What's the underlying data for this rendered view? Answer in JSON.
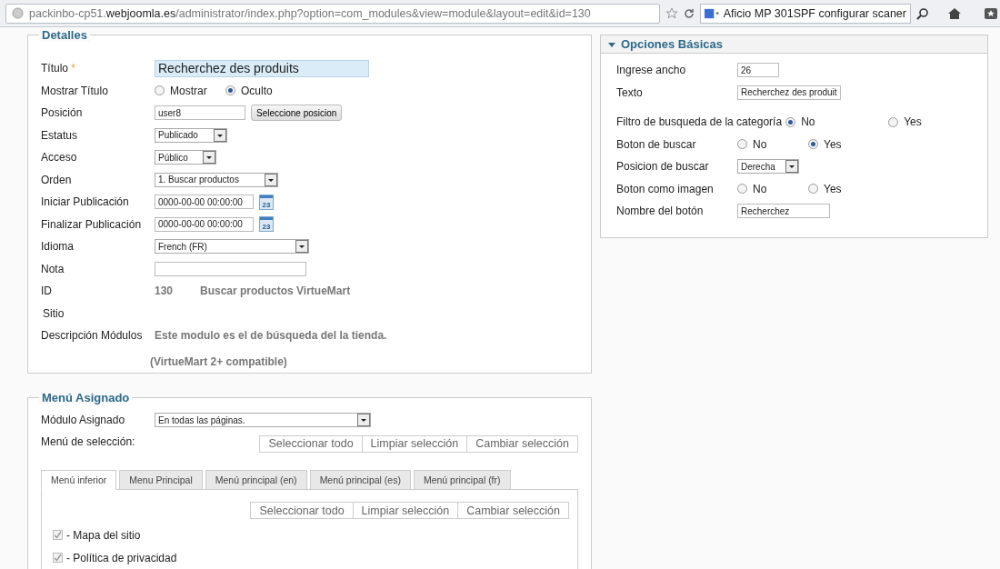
{
  "browser": {
    "url": "packinbo-cp51.**webjoomla.es**/administrator/index.php?option=com_modules&view=module&layout=edit&id=130",
    "search_text": "Aficio MP 301SPF configurar scaner"
  },
  "details": {
    "legend": "Detalles",
    "fields": [
      {
        "kind": "title",
        "label": "Título",
        "required_mark": "*",
        "value": "Recherchez des produits"
      },
      {
        "kind": "radio",
        "label": "Mostrar Título",
        "options": [
          {
            "label": "Mostrar",
            "selected": false
          },
          {
            "label": "Oculto",
            "selected": true
          }
        ]
      },
      {
        "kind": "text_button",
        "label": "Posición",
        "value": "user8",
        "button": "Seleccione posicion"
      },
      {
        "kind": "select",
        "label": "Estatus",
        "value": "Publicado"
      },
      {
        "kind": "select",
        "label": "Acceso",
        "value": "Público"
      },
      {
        "kind": "select",
        "label": "Orden",
        "value": "1. Buscar productos"
      },
      {
        "kind": "date",
        "label": "Iniciar Publicación",
        "value": "0000-00-00 00:00:00",
        "calendar_day": "23"
      },
      {
        "kind": "date",
        "label": "Finalizar Publicación",
        "value": "0000-00-00 00:00:00",
        "calendar_day": "23"
      },
      {
        "kind": "select",
        "label": "Idioma",
        "value": "French (FR)"
      },
      {
        "kind": "text",
        "label": "Nota"
      },
      {
        "kind": "id",
        "label": "ID",
        "value": "130",
        "name": "Buscar productos VirtueMart"
      },
      {
        "kind": "plain",
        "label": "Sitio"
      },
      {
        "kind": "description",
        "label": "Descripción Módulos",
        "lines": [
          "Este modulo es el de búsqueda del la tienda.",
          "(VirtueMart 2+ compatible)"
        ]
      }
    ]
  },
  "basic_options": {
    "title": "Opciones Básicas",
    "expanded": true,
    "fields": [
      {
        "kind": "text",
        "label": "Ingrese ancho",
        "value": "26"
      },
      {
        "kind": "text",
        "label": "Texto",
        "value": "Recherchez des produit"
      },
      {
        "kind": "radio",
        "label": "Filtro de busqueda de la categoría",
        "options": [
          {
            "label": "No",
            "selected": true
          },
          {
            "label": "Yes",
            "selected": false
          }
        ]
      },
      {
        "kind": "radio",
        "label": "Boton de buscar",
        "options": [
          {
            "label": "No",
            "selected": false
          },
          {
            "label": "Yes",
            "selected": true
          }
        ]
      },
      {
        "kind": "select",
        "label": "Posicion de buscar",
        "value": "Derecha"
      },
      {
        "kind": "radio",
        "label": "Boton como imagen",
        "options": [
          {
            "label": "No",
            "selected": false
          },
          {
            "label": "Yes",
            "selected": false
          }
        ]
      },
      {
        "kind": "text",
        "label": "Nombre del botón",
        "value": "Recherchez"
      }
    ]
  },
  "menu_assignment": {
    "legend": "Menú Asignado",
    "module_label": "Módulo Asignado",
    "module_value": "En todas las páginas.",
    "selection_label": "Menú de selección:",
    "buttons": [
      "Seleccionar todo",
      "Limpiar selección",
      "Cambiar selección"
    ],
    "tabs": [
      {
        "label": "Menú inferior",
        "selected": true
      },
      {
        "label": "Menu Principal",
        "selected": false
      },
      {
        "label": "Menú principal (en)",
        "selected": false
      },
      {
        "label": "Menú principal (es)",
        "selected": false
      },
      {
        "label": "Menú principal (fr)",
        "selected": false
      }
    ],
    "tab_buttons": [
      "Seleccionar todo",
      "Limpiar selección",
      "Cambiar selección"
    ],
    "items": [
      {
        "label": "- Mapa del sitio",
        "checked": true
      },
      {
        "label": "- Política de privacidad",
        "checked": true
      }
    ]
  }
}
